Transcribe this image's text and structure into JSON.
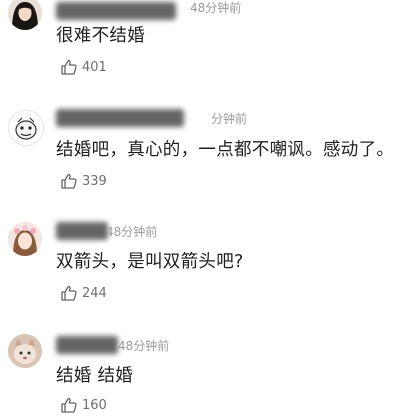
{
  "comments": [
    {
      "time": "48分钟前",
      "text": "很难不结婚",
      "likes": "401",
      "avatar_icon": "avatar-woman-dark-hair-icon"
    },
    {
      "time": "分钟前",
      "text": "结婚吧，真心的，一点都不嘲讽。感动了。",
      "likes": "339",
      "avatar_icon": "avatar-cartoon-face-icon"
    },
    {
      "time": "48分钟前",
      "text": "双箭头，是叫双箭头吧?",
      "likes": "244",
      "avatar_icon": "avatar-girl-flowers-icon"
    },
    {
      "time": "48分钟前",
      "text": "结婚 结婚",
      "likes": "160",
      "avatar_icon": "avatar-pet-photo-icon"
    }
  ],
  "colors": {
    "text": "#1f1f1f",
    "meta": "#9b9b9b",
    "likes": "#6f6f6f"
  }
}
